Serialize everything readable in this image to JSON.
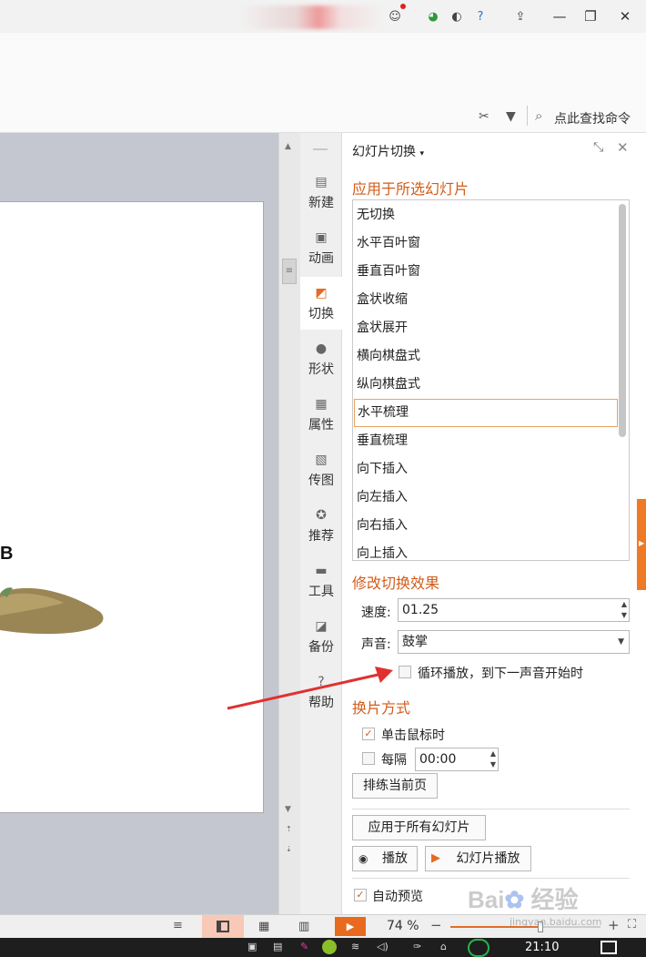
{
  "title_bar": {
    "icons": [
      "user-icon",
      "browser-icon",
      "skin-icon",
      "help-icon",
      "upload-icon"
    ],
    "window_buttons": {
      "minimize": "—",
      "restore": "❐",
      "close": "✕"
    }
  },
  "ribbon": {
    "find_command": "点此查找命令"
  },
  "slide": {
    "label_b": "B"
  },
  "rail": {
    "items": [
      {
        "label": "新建",
        "icon": "new-doc-icon",
        "glyph": "▤"
      },
      {
        "label": "动画",
        "icon": "animation-icon",
        "glyph": "▣"
      },
      {
        "label": "切换",
        "icon": "transition-icon",
        "glyph": "◩"
      },
      {
        "label": "形状",
        "icon": "shape-icon",
        "glyph": "●"
      },
      {
        "label": "属性",
        "icon": "property-icon",
        "glyph": "▦"
      },
      {
        "label": "传图",
        "icon": "image-upload-icon",
        "glyph": "▧"
      },
      {
        "label": "推荐",
        "icon": "recommend-icon",
        "glyph": "✪"
      },
      {
        "label": "工具",
        "icon": "toolbox-icon",
        "glyph": "▬"
      },
      {
        "label": "备份",
        "icon": "backup-icon",
        "glyph": "◪"
      },
      {
        "label": "帮助",
        "icon": "help-icon",
        "glyph": "?"
      }
    ]
  },
  "pane": {
    "title": "幻灯片切换",
    "apply_heading": "应用于所选幻灯片",
    "transitions": [
      "无切换",
      "水平百叶窗",
      "垂直百叶窗",
      "盒状收缩",
      "盒状展开",
      "横向棋盘式",
      "纵向棋盘式",
      "水平梳理",
      "垂直梳理",
      "向下插入",
      "向左插入",
      "向右插入",
      "向上插入"
    ],
    "selected_transition": "水平梳理",
    "modify_heading": "修改切换效果",
    "speed_label": "速度:",
    "speed_value": "01.25",
    "sound_label": "声音:",
    "sound_value": "鼓掌",
    "loop_label": "循环播放，到下一声音开始时",
    "advance_heading": "换片方式",
    "on_click_label": "单击鼠标时",
    "on_click_checked": true,
    "every_label": "每隔",
    "every_value": "00:00",
    "every_checked": false,
    "rehearse_button": "排练当前页",
    "apply_all_button": "应用于所有幻灯片",
    "play_button": "播放",
    "slideshow_button": "幻灯片播放",
    "auto_preview_label": "自动预览",
    "auto_preview_checked": true
  },
  "status_bar": {
    "zoom": "74 %",
    "zoom_fraction": 0.6
  },
  "taskbar": {
    "time": "21:10"
  },
  "colors": {
    "accent": "#d35c1a",
    "selection_border": "#e8a25f",
    "edge_tab": "#ef7a26",
    "arrow": "#e03030"
  }
}
